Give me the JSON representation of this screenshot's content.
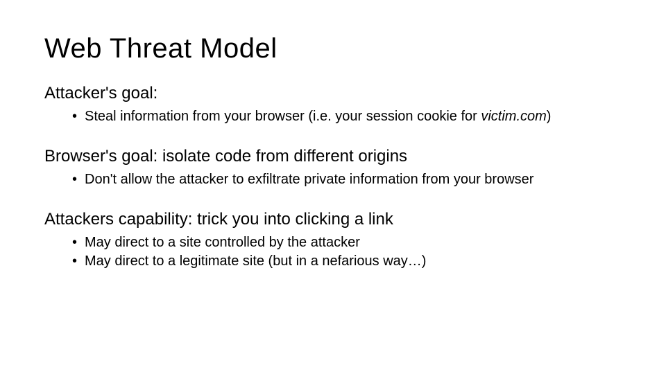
{
  "slide": {
    "title": "Web Threat Model",
    "sections": [
      {
        "heading": "Attacker's goal:",
        "bullets": [
          {
            "pre": "Steal information from your browser (i.e. your session cookie for ",
            "italic": "victim.com",
            "post": ")"
          }
        ]
      },
      {
        "heading": "Browser's goal: isolate code from different origins",
        "bullets": [
          {
            "pre": "Don't allow the attacker to exfiltrate private information from your browser",
            "italic": "",
            "post": ""
          }
        ]
      },
      {
        "heading": "Attackers capability: trick you into clicking a link",
        "bullets": [
          {
            "pre": "May direct to a site controlled by the attacker",
            "italic": "",
            "post": ""
          },
          {
            "pre": "May direct to a legitimate site (but in a nefarious way…)",
            "italic": "",
            "post": ""
          }
        ]
      }
    ]
  }
}
